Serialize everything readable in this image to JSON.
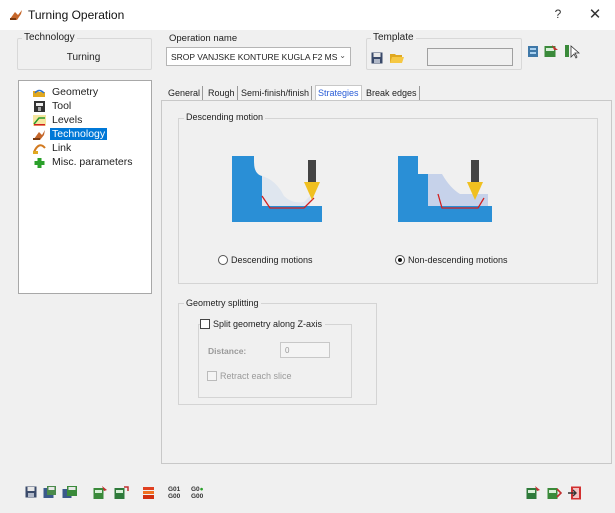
{
  "window": {
    "title": "Turning Operation",
    "help_label": "?",
    "close_label": "✕"
  },
  "technology_group": {
    "label": "Technology",
    "value": "Turning"
  },
  "operation_name": {
    "label": "Operation name",
    "value": "SROP VANJSKE KONTURE KUGLA F2 MS"
  },
  "template": {
    "label": "Template",
    "value": ""
  },
  "tree": {
    "items": [
      {
        "label": "Geometry",
        "icon": "geometry-icon"
      },
      {
        "label": "Tool",
        "icon": "tool-icon"
      },
      {
        "label": "Levels",
        "icon": "levels-icon"
      },
      {
        "label": "Technology",
        "icon": "technology-icon",
        "selected": true
      },
      {
        "label": "Link",
        "icon": "link-icon"
      },
      {
        "label": "Misc. parameters",
        "icon": "plus-icon"
      }
    ]
  },
  "tabs": [
    {
      "label": "General"
    },
    {
      "label": "Rough"
    },
    {
      "label": "Semi-finish/finish"
    },
    {
      "label": "Strategies",
      "active": true
    },
    {
      "label": "Break edges"
    }
  ],
  "descending": {
    "label": "Descending motion",
    "option1": "Descending motions",
    "option2": "Non-descending motions",
    "selected": "Non-descending motions"
  },
  "splitting": {
    "label": "Geometry splitting",
    "split_label": "Split geometry along Z-axis",
    "split_checked": false,
    "distance_label": "Distance:",
    "distance_value": "0",
    "retract_label": "Retract each slice",
    "retract_checked": false
  },
  "bottom_toolbar": {
    "g_codes_1": [
      "G01",
      "G00"
    ],
    "g_codes_2": [
      "G0",
      "G00"
    ]
  },
  "colors": {
    "selection": "#0078d7",
    "part_blue": "#2a8fd6",
    "active_tab": "#2a5dd7",
    "toolpath_red": "#d22020"
  }
}
